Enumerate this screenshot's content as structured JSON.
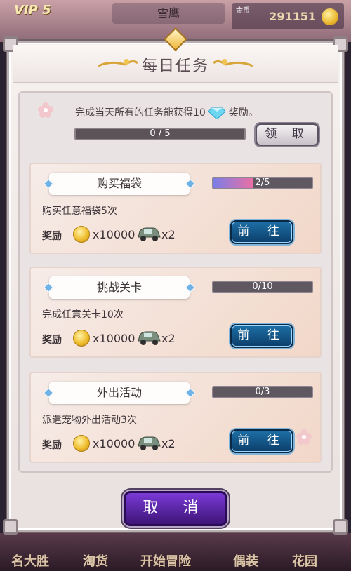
{
  "background": {
    "vip": "VIP 5",
    "player_name": "雪鹰",
    "gold_label": "金币",
    "gold_value": "291151",
    "bottom_tabs": [
      "名大胜",
      "淘货",
      "开始冒险",
      "偶装",
      "花园"
    ]
  },
  "dialog": {
    "title": "每日任务",
    "intro_prefix": "完成当天所有的任务能获得10",
    "intro_suffix": "奖励。",
    "total_progress": "0 / 5",
    "claim_label": "领 取",
    "cancel_label": "取 消",
    "reward_label": "奖励",
    "go_label": "前 往"
  },
  "tasks": [
    {
      "title": "购买福袋",
      "progress": "2/5",
      "progress_fraction": 0.4,
      "desc": "购买任意福袋5次",
      "coin": "x10000",
      "car": "x2"
    },
    {
      "title": "挑战关卡",
      "progress": "0/10",
      "progress_fraction": 0,
      "desc": "完成任意关卡10次",
      "coin": "x10000",
      "car": "x2"
    },
    {
      "title": "外出活动",
      "progress": "0/3",
      "progress_fraction": 0,
      "desc": "派遣宠物外出活动3次",
      "coin": "x10000",
      "car": "x2"
    }
  ],
  "colors": {
    "go_button": "#1d6fa6",
    "cancel_button": "#7a3ad6",
    "progress_fill_start": "#7a7ee6",
    "progress_fill_end": "#ea6fa5"
  }
}
